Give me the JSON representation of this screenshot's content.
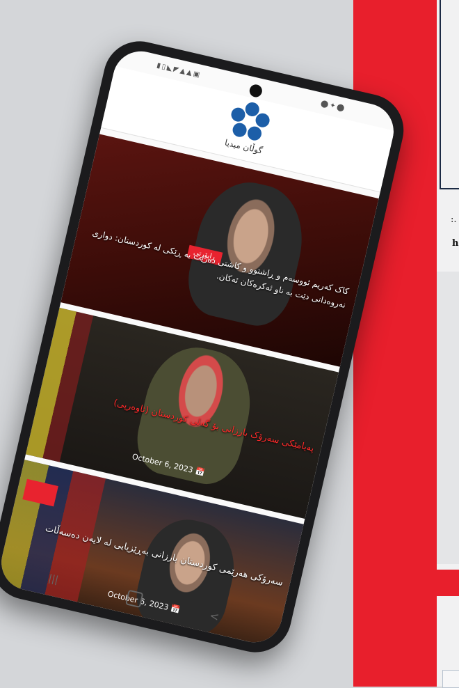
{
  "right_panel": {
    "text_line1": ":.",
    "text_line2": "h"
  },
  "phone": {
    "status_left": "▮▯◣◤▲▲▣",
    "status_right": "⬤✦⬤",
    "app": {
      "logo_text": "گوڵان میدیا",
      "articles": [
        {
          "badge": "ڕاپۆرتی",
          "title": "کاک کەریم ئووسەم و ڕاشتوو و کاشتی دەرێت بە ڕێکی لە کوردستان: دواری نەروەدانی دێت بە ناو ئەکرەکان ئەکان."
        },
        {
          "title": "پەیامێکی سەرۆک بارزانی بۆ گەلی کوردستان (ئاوەرپی)",
          "date": "October 6, 2023"
        },
        {
          "title": "سەرۆکی هەرێمی کوردستان بارزانی بەڕێزیایی لە لایەن دەسەڵات",
          "date": "October 6, 2023"
        }
      ]
    }
  },
  "icons": {
    "calendar": "calendar-icon",
    "gear": "gear-icon",
    "logo": "flower-logo-icon"
  },
  "colors": {
    "red": "#e81f2c",
    "logo_blue": "#1c5ea8"
  }
}
